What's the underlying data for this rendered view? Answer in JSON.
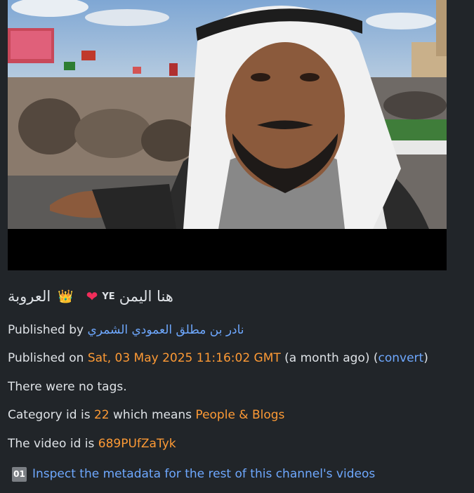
{
  "video": {
    "title_ar": "العروبة",
    "crown_emoji": "👑",
    "heart_emoji": "❤",
    "flag_text": "YE",
    "title_ar_2": "هنا اليمن"
  },
  "meta": {
    "published_by_label": "Published by",
    "channel_name": "نادر بن مطلق العمودي الشمري",
    "published_on_label": "Published on",
    "published_date": "Sat, 03 May 2025 11:16:02 GMT",
    "relative_time": "(a month ago)",
    "convert_open": "(",
    "convert_label": "convert",
    "convert_close": ")",
    "tags_text": "There were no tags.",
    "category_prefix": "Category id is",
    "category_id": "22",
    "category_middle": "which means",
    "category_name": "People & Blogs",
    "video_id_prefix": "The video id is",
    "video_id": "689PUfZaTyk",
    "inspect_badge": "01",
    "inspect_link": "Inspect the metadata for the rest of this channel's videos"
  },
  "colors": {
    "background": "#212529",
    "text": "#dee2e6",
    "link": "#6ea8fe",
    "accent": "#fd9a35",
    "badge": "#7b7f84"
  }
}
